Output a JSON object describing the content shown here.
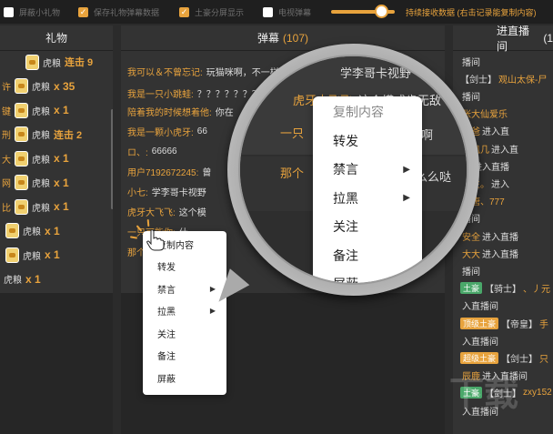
{
  "toolbar": {
    "options": [
      {
        "label": "屏蔽小礼物",
        "checked": false
      },
      {
        "label": "保存礼物弹幕数据",
        "checked": true
      },
      {
        "label": "土豪分屏显示",
        "checked": true
      },
      {
        "label": "电视弹幕",
        "checked": false
      }
    ],
    "slider_label": "持续接收数据 (右击记录能复制内容)",
    "accent": "#e8a33d"
  },
  "gifts": {
    "title": "礼物",
    "rows": [
      {
        "user": "",
        "name": "虎粮",
        "qty": "",
        "tag": "连击 9"
      },
      {
        "user": "许",
        "name": "虎粮",
        "qty": "x 35",
        "tag": ""
      },
      {
        "user": "键",
        "name": "虎粮",
        "qty": "x 1",
        "tag": ""
      },
      {
        "user": "刑",
        "name": "虎粮",
        "qty": "",
        "tag": "连击 2"
      },
      {
        "user": "大",
        "name": "虎粮",
        "qty": "x 1",
        "tag": ""
      },
      {
        "user": "网",
        "name": "虎粮",
        "qty": "x 1",
        "tag": ""
      },
      {
        "user": "比",
        "name": "虎粮",
        "qty": "x 1",
        "tag": ""
      },
      {
        "user": "",
        "name": "虎粮",
        "qty": "x 1",
        "tag": ""
      },
      {
        "user": "",
        "name": "虎粮",
        "qty": "x 1",
        "tag": ""
      },
      {
        "user": "",
        "name": "虎粮",
        "qty": "x 1",
        "tag": ""
      }
    ]
  },
  "danmaku": {
    "title": "弹幕",
    "count": "(107)",
    "messages": [
      {
        "user": "我可以＆不曾忘记:",
        "text": "玩猫咪啊，不一样的"
      },
      {
        "user": "我是一只小跳蛙:",
        "text": "？？？？？？？"
      },
      {
        "user": "陪着我的时候想着他:",
        "text": "你在"
      },
      {
        "user": "我是一颗小虎牙:",
        "text": "66"
      },
      {
        "user": "ロ、:",
        "text": "66666"
      },
      {
        "user": "用户7192672245:",
        "text": "曾"
      },
      {
        "user": "小七:",
        "text": "学李哥卡视野"
      },
      {
        "user": "虎牙大飞飞:",
        "text": "这个模"
      },
      {
        "user": "一只可能你:",
        "text": "什"
      },
      {
        "user": "那个",
        "text": ""
      }
    ]
  },
  "entries": {
    "title": "进直播间",
    "count": "(1",
    "items": [
      {
        "badge": "",
        "badge_color": "",
        "rank": "",
        "name": "",
        "text": "播间"
      },
      {
        "badge": "",
        "badge_color": "",
        "rank": "【剑士】",
        "name": "观山太保-尸",
        "text": ""
      },
      {
        "badge": "",
        "badge_color": "",
        "rank": "",
        "name": "",
        "text": "播间"
      },
      {
        "badge": "",
        "badge_color": "",
        "rank": "",
        "name": "张大仙爱乐",
        "text": ""
      },
      {
        "badge": "",
        "badge_color": "",
        "rank": "",
        "name": "爸爸",
        "text": "进入直"
      },
      {
        "badge": "",
        "badge_color": "",
        "rank": "",
        "name": "凤凰几",
        "text": "进入直"
      },
      {
        "badge": "",
        "badge_color": "",
        "rank": "",
        "name": "见",
        "text": "进入直播"
      },
      {
        "badge": "",
        "badge_color": "",
        "rank": "",
        "name": "学生。",
        "text": "进入"
      },
      {
        "badge": "",
        "badge_color": "",
        "rank": "",
        "name": "永唐、777",
        "text": ""
      },
      {
        "badge": "",
        "badge_color": "",
        "rank": "",
        "name": "",
        "text": "播间"
      },
      {
        "badge": "",
        "badge_color": "",
        "rank": "",
        "name": "安全",
        "text": "进入直播"
      },
      {
        "badge": "",
        "badge_color": "",
        "rank": "",
        "name": "大大",
        "text": "进入直播"
      },
      {
        "badge": "",
        "badge_color": "",
        "rank": "",
        "name": "",
        "text": "播间"
      },
      {
        "badge": "土豪",
        "badge_color": "#4aa86a",
        "rank": "【骑士】",
        "name": "、丿元",
        "text": ""
      },
      {
        "badge": "",
        "badge_color": "",
        "rank": "",
        "name": "",
        "text": "入直播间"
      },
      {
        "badge": "顶级土豪",
        "badge_color": "#e8a33d",
        "rank": "【帝皇】",
        "name": "手",
        "text": ""
      },
      {
        "badge": "",
        "badge_color": "",
        "rank": "",
        "name": "",
        "text": "入直播间"
      },
      {
        "badge": "超级土豪",
        "badge_color": "#e8a33d",
        "rank": "【剑士】",
        "name": "只",
        "text": ""
      },
      {
        "badge": "",
        "badge_color": "",
        "rank": "",
        "name": "辰鹿",
        "text": "进入直播间"
      },
      {
        "badge": "土豪",
        "badge_color": "#4aa86a",
        "rank": "【剑士】",
        "name": "zxy152",
        "text": ""
      },
      {
        "badge": "",
        "badge_color": "",
        "rank": "",
        "name": "",
        "text": "入直播间"
      }
    ]
  },
  "context_menu": {
    "items": [
      "复制内容",
      "转发",
      "禁言",
      "拉黑",
      "关注",
      "备注",
      "屏蔽"
    ],
    "submenu_items": [
      "禁言",
      "拉黑"
    ]
  },
  "magnifier_background": {
    "lines": [
      {
        "text": "学李哥卡视野",
        "color": "#ddd"
      },
      {
        "text": "虎牙大飞飞:",
        "color": "#e8a33d"
      },
      {
        "text": "这个模式肯无敌",
        "color": "#ddd"
      },
      {
        "text": "一只",
        "color": "#e8a33d"
      },
      {
        "text": "候出的啊",
        "color": "#ddd"
      },
      {
        "text": "那个",
        "color": "#e8a33d"
      },
      {
        "text": "个么么哒",
        "color": "#ddd"
      }
    ]
  },
  "watermark": "下载"
}
